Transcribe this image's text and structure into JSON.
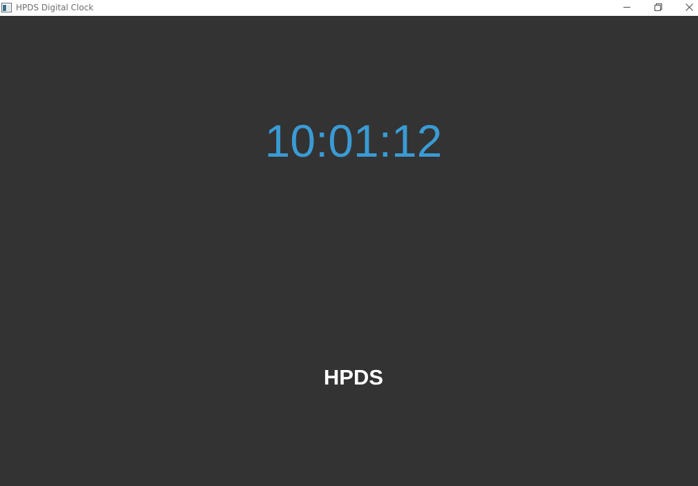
{
  "window": {
    "title": "HPDS Digital Clock",
    "icons": {
      "app": "app-window-icon",
      "minimize": "minimize-icon",
      "maximize": "restore-icon",
      "close": "close-icon"
    }
  },
  "clock": {
    "time": "10:01:12",
    "color": "#3a9bd4"
  },
  "brand": {
    "label": "HPDS",
    "color": "#ffffff"
  },
  "colors": {
    "background": "#333333",
    "titlebar": "#ffffff"
  }
}
